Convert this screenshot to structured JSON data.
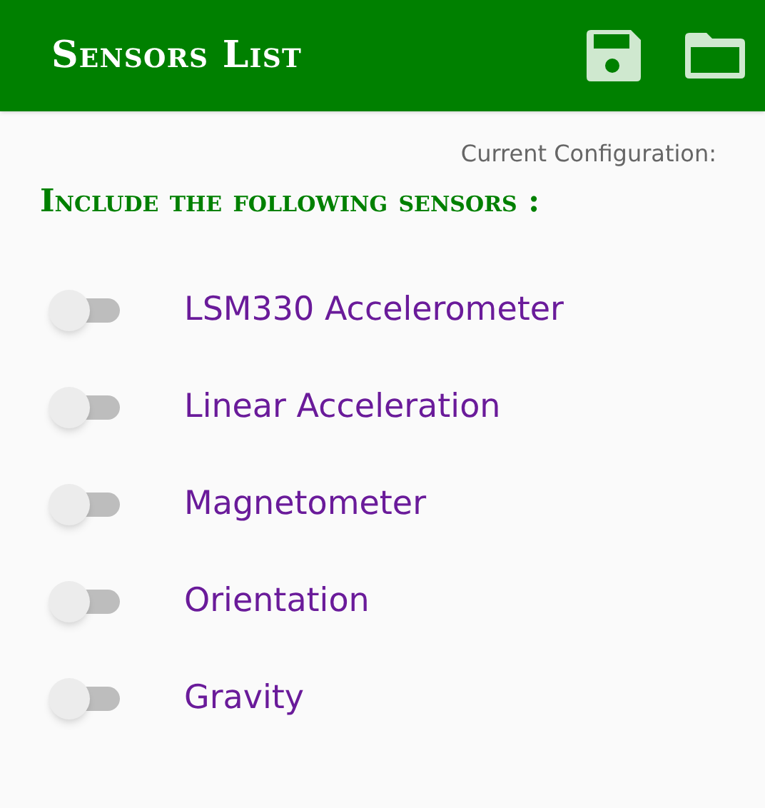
{
  "app_bar": {
    "title": "Sensors List"
  },
  "config_label": "Current Configuration:",
  "heading": "Include the following sensors :",
  "sensors": [
    {
      "label": "LSM330 Accelerometer",
      "on": false
    },
    {
      "label": "Linear Acceleration",
      "on": false
    },
    {
      "label": "Magnetometer",
      "on": false
    },
    {
      "label": "Orientation",
      "on": false
    },
    {
      "label": "Gravity",
      "on": false
    }
  ]
}
